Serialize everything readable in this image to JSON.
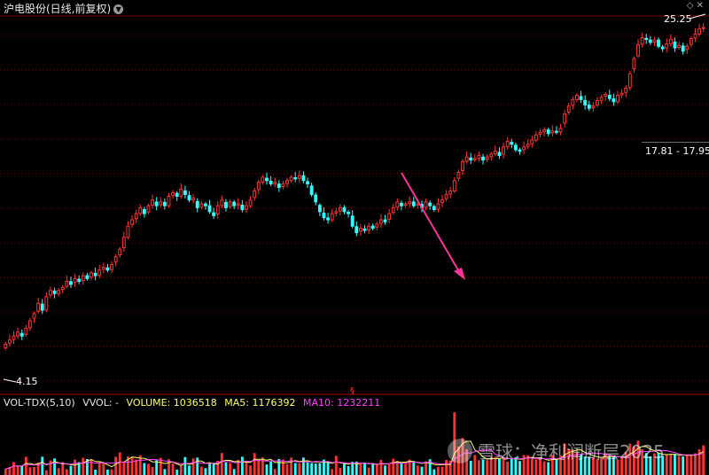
{
  "header": {
    "title": "沪电股份(日线,前复权)",
    "dropdown_icon": "chevron-down-icon"
  },
  "top_icons": [
    "diamond-icon",
    "close-icon"
  ],
  "price_labels": {
    "high": "25.25",
    "low": "4.15",
    "range": "17.81 - 17.95",
    "marker": "§"
  },
  "volume_header": {
    "indicator": "VOL-TDX(5,10)",
    "vvol": "VVOL: -",
    "volume": "VOLUME: 1036518",
    "ma5": "MA5: 1176392",
    "ma10": "MA10: 1232211"
  },
  "watermark": "雪球：净利润断层2025",
  "colors": {
    "up": "#ff3333",
    "down": "#33ffff",
    "ma5": "#ffff66",
    "ma10": "#ff44ff",
    "arrow": "#ff3399",
    "grid": "#7a0000",
    "volume_label": "#ffff66",
    "ma10_label": "#ff44ff"
  },
  "chart_data": {
    "type": "candlestick",
    "title": "沪电股份(日线,前复权)",
    "price_ylim": [
      3.4,
      26.5
    ],
    "price_high": 25.25,
    "price_low": 4.15,
    "annotated_range": [
      17.81,
      17.95
    ],
    "closes": [
      4.3,
      4.4,
      4.5,
      4.6,
      4.5,
      4.7,
      4.9,
      5.1,
      5.4,
      5.2,
      5.6,
      5.8,
      5.7,
      5.8,
      5.9,
      6.1,
      6.0,
      6.2,
      6.1,
      6.3,
      6.2,
      6.4,
      6.3,
      6.5,
      6.6,
      6.5,
      6.7,
      7.0,
      7.3,
      7.8,
      8.3,
      8.6,
      8.9,
      9.2,
      8.9,
      9.3,
      9.6,
      9.3,
      9.5,
      9.3,
      9.8,
      10.0,
      9.8,
      10.2,
      9.9,
      9.6,
      9.7,
      9.2,
      9.4,
      9.3,
      9.0,
      8.8,
      9.3,
      9.6,
      9.2,
      9.5,
      9.3,
      9.4,
      9.1,
      9.3,
      9.6,
      10.1,
      10.6,
      10.9,
      10.7,
      10.5,
      10.6,
      10.3,
      10.5,
      10.7,
      10.9,
      10.8,
      11.0,
      10.7,
      10.5,
      9.9,
      9.5,
      9.0,
      8.7,
      8.6,
      8.9,
      9.0,
      9.2,
      9.0,
      8.9,
      8.3,
      8.0,
      8.2,
      8.1,
      8.3,
      8.2,
      8.4,
      8.6,
      8.5,
      8.9,
      9.2,
      9.5,
      9.3,
      9.4,
      9.5,
      9.3,
      9.4,
      9.2,
      9.5,
      9.3,
      9.1,
      9.4,
      9.6,
      9.9,
      10.1,
      10.7,
      11.2,
      11.9,
      12.2,
      12.0,
      12.1,
      12.3,
      12.0,
      12.2,
      12.4,
      12.6,
      12.3,
      12.9,
      13.3,
      13.1,
      12.7,
      12.6,
      12.9,
      13.1,
      13.4,
      13.8,
      14.0,
      14.2,
      13.9,
      14.1,
      14.0,
      14.3,
      15.5,
      16.2,
      16.8,
      17.2,
      16.8,
      16.3,
      16.0,
      16.2,
      16.7,
      17.0,
      17.3,
      16.9,
      16.6,
      17.2,
      17.4,
      17.9,
      19.4,
      21.1,
      22.8,
      23.7,
      23.5,
      23.1,
      23.4,
      22.6,
      22.3,
      22.9,
      23.5,
      22.4,
      22.7,
      22.0,
      22.6,
      23.6,
      24.2,
      24.9,
      25.1
    ],
    "volumes": [
      0.21,
      0.28,
      0.45,
      0.32,
      0.33,
      0.64,
      0.27,
      0.28,
      0.44,
      0.64,
      0.17,
      0.51,
      0.58,
      0.24,
      0.45,
      0.2,
      0.32,
      0.54,
      0.45,
      0.6,
      0.56,
      0.56,
      0.19,
      0.44,
      0.43,
      0.19,
      0.2,
      0.64,
      0.79,
      0.45,
      0.65,
      0.63,
      0.54,
      0.69,
      0.42,
      0.39,
      0.28,
      0.52,
      0.6,
      0.21,
      0.55,
      0.4,
      0.19,
      0.32,
      0.63,
      0.33,
      0.58,
      0.61,
      0.29,
      0.24,
      0.44,
      0.43,
      0.5,
      0.77,
      0.44,
      0.42,
      0.21,
      0.53,
      0.64,
      0.49,
      0.33,
      0.77,
      0.52,
      0.62,
      0.37,
      0.47,
      0.21,
      0.56,
      0.54,
      0.38,
      0.61,
      0.42,
      0.42,
      0.61,
      0.44,
      0.42,
      0.4,
      0.42,
      0.54,
      0.48,
      0.21,
      0.67,
      0.25,
      0.42,
      0.31,
      0.46,
      0.47,
      0.39,
      0.43,
      0.26,
      0.41,
      0.36,
      0.53,
      0.33,
      0.38,
      0.57,
      0.5,
      0.42,
      0.39,
      0.54,
      0.49,
      0.33,
      0.29,
      0.48,
      0.55,
      0.2,
      0.29,
      0.29,
      0.53,
      0.5,
      2.2,
      1.0,
      1.3,
      0.9,
      0.5,
      0.7,
      0.52,
      0.54,
      0.52,
      0.63,
      0.64,
      0.57,
      0.62,
      0.47,
      0.56,
      0.62,
      0.49,
      0.7,
      0.69,
      0.56,
      0.55,
      0.54,
      0.48,
      0.45,
      0.7,
      0.56,
      0.69,
      1.1,
      0.9,
      0.9,
      0.8,
      0.71,
      0.65,
      0.64,
      0.61,
      0.57,
      0.63,
      0.76,
      0.63,
      0.67,
      0.53,
      0.6,
      0.8,
      1.1,
      1.0,
      1.2,
      0.9,
      0.77,
      0.65,
      0.76,
      0.78,
      0.67,
      0.72,
      0.71,
      0.74,
      0.67,
      0.65,
      0.69,
      0.71,
      0.76,
      0.9,
      1.04
    ]
  }
}
